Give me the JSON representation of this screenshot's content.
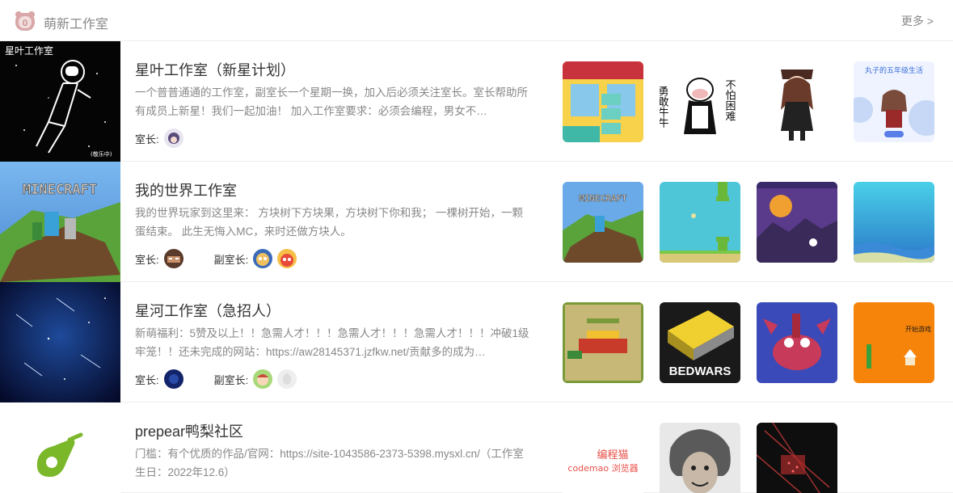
{
  "header": {
    "logo_glyph": "0",
    "title": "萌新工作室",
    "more": "更多 >"
  },
  "studios": [
    {
      "thumb_text": "星叶工作室",
      "thumb_caption": "(敬乐中)",
      "name": "星叶工作室（新星计划）",
      "desc": "一个普普通通的工作室，副室长一个星期一换，加入后必须关注室长。室长帮助所有成员上新星！我们一起加油！ 加入工作室要求：必须会编程，男女不…",
      "owner_label": "室长:",
      "works": [
        {
          "label": ""
        },
        {
          "left": "勇敢牛牛",
          "right": "不怕困难"
        },
        {
          "label": ""
        },
        {
          "label": "丸子的五年级生活"
        }
      ]
    },
    {
      "thumb_text": "MINECRAFT",
      "name": "我的世界工作室",
      "desc": "我的世界玩家到这里来： 方块树下方块果，方块树下你和我； 一棵树开始，一颗蛋结束。 此生无悔入MC，来时还做方块人。",
      "owner_label": "室长:",
      "vice_label": "副室长:",
      "works": [
        {
          "label": "MINECRAFT"
        },
        {
          "label": ""
        },
        {
          "label": ""
        },
        {
          "label": ""
        }
      ]
    },
    {
      "name": "星河工作室（急招人）",
      "desc": "新萌福利：5赞及以上！！急需人才！！！急需人才！！！急需人才！！！冲破1级牢笼！！还未完成的网站：https://aw28145371.jzfkw.net/贡献多的成为…",
      "owner_label": "室长:",
      "vice_label": "副室长:",
      "works": [
        {
          "label": ""
        },
        {
          "label": "BEDWARS"
        },
        {
          "label": ""
        },
        {
          "label": "开始游戏"
        }
      ]
    },
    {
      "name": "prepear鸭梨社区",
      "desc": "门槛：有个优质的作品/官网：https://site-1043586-2373-5398.mysxl.cn/（工作室生日：2022年12.6）",
      "works": [
        {
          "label": "编程猫",
          "label2": "codemao 浏览器"
        },
        {
          "label": ""
        },
        {
          "label": ""
        }
      ]
    }
  ]
}
